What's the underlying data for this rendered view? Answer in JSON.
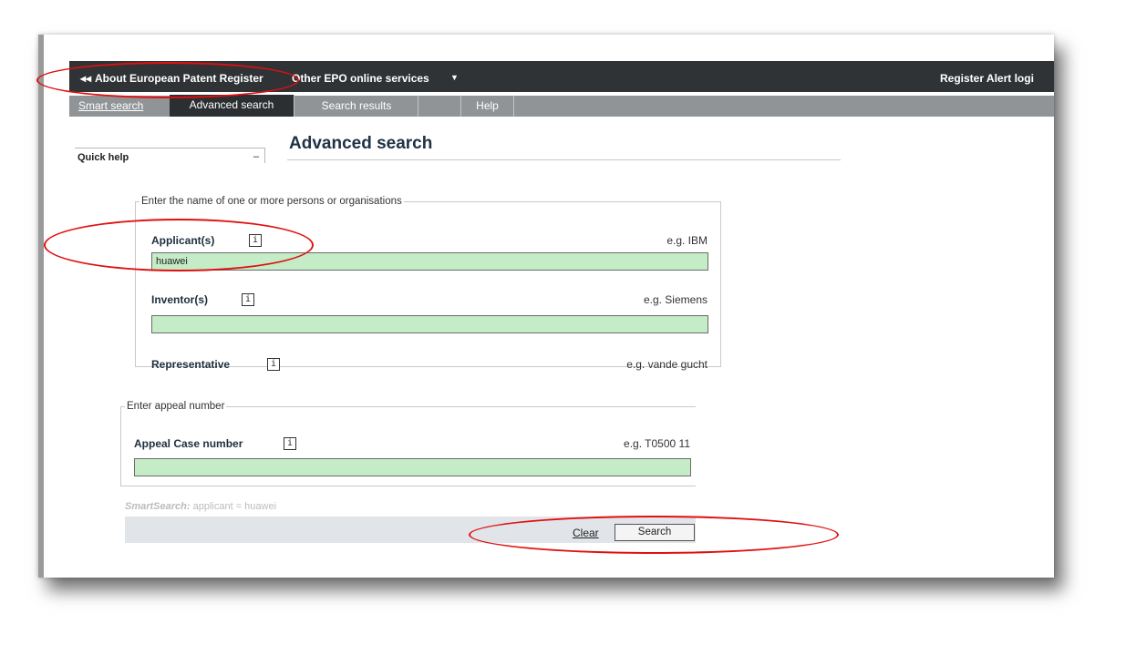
{
  "colors": {
    "topbar": "#2f3336",
    "tabbar": "#909497",
    "active_tab": "#2b2f31",
    "input_fill": "#c4ecc6",
    "annotation_red": "#e01010"
  },
  "topbar": {
    "back_icon": "double-left-arrow-icon",
    "back_glyph": "◂◂",
    "about_label": "About European Patent Register",
    "other_services_label": "Other EPO online services",
    "dropdown_icon": "caret-down-icon",
    "dropdown_glyph": "▼",
    "alert_login_label": "Register Alert logi"
  },
  "tabs": [
    {
      "label": "Smart search",
      "active": false
    },
    {
      "label": "Advanced search",
      "active": true
    },
    {
      "label": "Search results",
      "active": false
    },
    {
      "label": "",
      "active": false
    },
    {
      "label": "Help",
      "active": false
    }
  ],
  "quick_help": {
    "label": "Quick help",
    "minimize_glyph": "–",
    "minimize_icon": "minimize-icon"
  },
  "page_title": "Advanced search",
  "persons": {
    "legend": "Enter the name of one or more persons or organisations",
    "fields": [
      {
        "label": "Applicant(s)",
        "example": "e.g. IBM",
        "value": "huawei"
      },
      {
        "label": "Inventor(s)",
        "example": "e.g. Siemens",
        "value": ""
      },
      {
        "label": "Representative",
        "example": "e.g. vande gucht",
        "value": ""
      }
    ]
  },
  "info_icon": {
    "name": "info-icon",
    "glyph": "i"
  },
  "appeal": {
    "legend": "Enter appeal number",
    "label": "Appeal Case number",
    "example": "e.g. T0500 11",
    "value": ""
  },
  "smartsearch": {
    "prefix": "SmartSearch:",
    "query": " applicant = huawei"
  },
  "actions": {
    "clear_label": "Clear",
    "search_label": "Search"
  }
}
